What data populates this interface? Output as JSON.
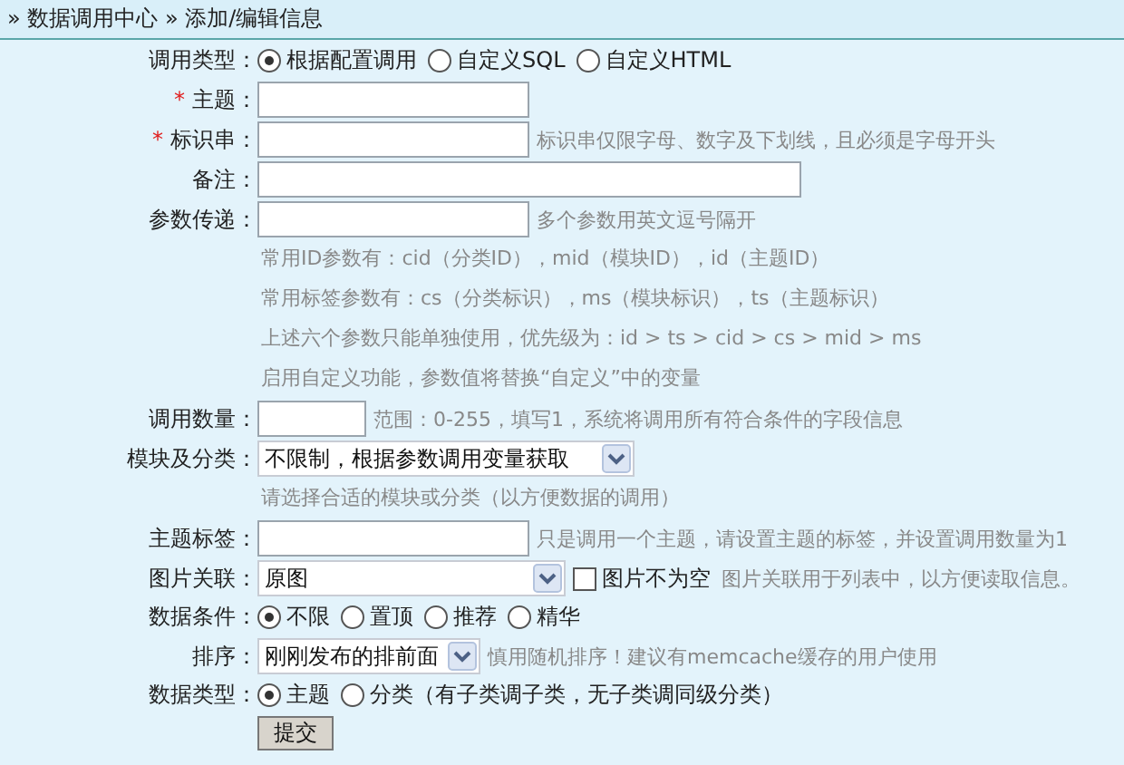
{
  "breadcrumb": "» 数据调用中心 » 添加/编辑信息",
  "rows": [
    {
      "label": "调用类型：",
      "controls": [
        {
          "kind": "radio",
          "label": "根据配置调用",
          "selected": true
        },
        {
          "kind": "radio",
          "label": "自定义SQL",
          "selected": false
        },
        {
          "kind": "radio",
          "label": "自定义HTML",
          "selected": false
        }
      ]
    },
    {
      "label": "主题：",
      "required_mark": "*",
      "controls": [
        {
          "kind": "input"
        }
      ]
    },
    {
      "label": "标识串：",
      "required_mark": "*",
      "controls": [
        {
          "kind": "input"
        },
        {
          "kind": "hint",
          "text": "标识串仅限字母、数字及下划线，且必须是字母开头"
        }
      ]
    },
    {
      "label": "备注：",
      "controls": [
        {
          "kind": "input"
        }
      ]
    },
    {
      "label": "参数传递：",
      "controls": [
        {
          "kind": "input"
        },
        {
          "kind": "hint",
          "text": "多个参数用英文逗号隔开"
        }
      ],
      "notes": [
        "常用ID参数有：cid（分类ID），mid（模块ID），id（主题ID）",
        "常用标签参数有：cs（分类标识），ms（模块标识），ts（主题标识）",
        "上述六个参数只能单独使用，优先级为：id > ts > cid > cs > mid > ms",
        "启用自定义功能，参数值将替换“自定义”中的变量"
      ]
    },
    {
      "label": "调用数量：",
      "controls": [
        {
          "kind": "input"
        },
        {
          "kind": "hint",
          "text": "范围：0-255，填写1，系统将调用所有符合条件的字段信息"
        }
      ]
    },
    {
      "label": "模块及分类：",
      "controls": [
        {
          "kind": "select",
          "value": "不限制，根据参数调用变量获取"
        }
      ],
      "notes": [
        "请选择合适的模块或分类（以方便数据的调用）"
      ]
    },
    {
      "label": "主题标签：",
      "controls": [
        {
          "kind": "input"
        },
        {
          "kind": "hint",
          "text": "只是调用一个主题，请设置主题的标签，并设置调用数量为1"
        }
      ]
    },
    {
      "label": "图片关联：",
      "controls": [
        {
          "kind": "select",
          "value": "原图"
        },
        {
          "kind": "checkbox",
          "label": "图片不为空",
          "checked": false
        },
        {
          "kind": "hint",
          "text": "图片关联用于列表中，以方便读取信息。"
        }
      ]
    },
    {
      "label": "数据条件：",
      "controls": [
        {
          "kind": "radio",
          "label": "不限",
          "selected": true
        },
        {
          "kind": "radio",
          "label": "置顶",
          "selected": false
        },
        {
          "kind": "radio",
          "label": "推荐",
          "selected": false
        },
        {
          "kind": "radio",
          "label": "精华",
          "selected": false
        }
      ]
    },
    {
      "label": "排序：",
      "controls": [
        {
          "kind": "select",
          "value": "刚刚发布的排前面"
        },
        {
          "kind": "hint",
          "text": "慎用随机排序！建议有memcache缓存的用户使用"
        }
      ]
    },
    {
      "label": "数据类型：",
      "controls": [
        {
          "kind": "radio",
          "label": "主题",
          "selected": true
        },
        {
          "kind": "radio",
          "label": "分类（有子类调子类，无子类调同级分类）",
          "selected": false
        }
      ]
    },
    {
      "controls": [
        {
          "kind": "button",
          "label": "提交"
        }
      ]
    }
  ]
}
